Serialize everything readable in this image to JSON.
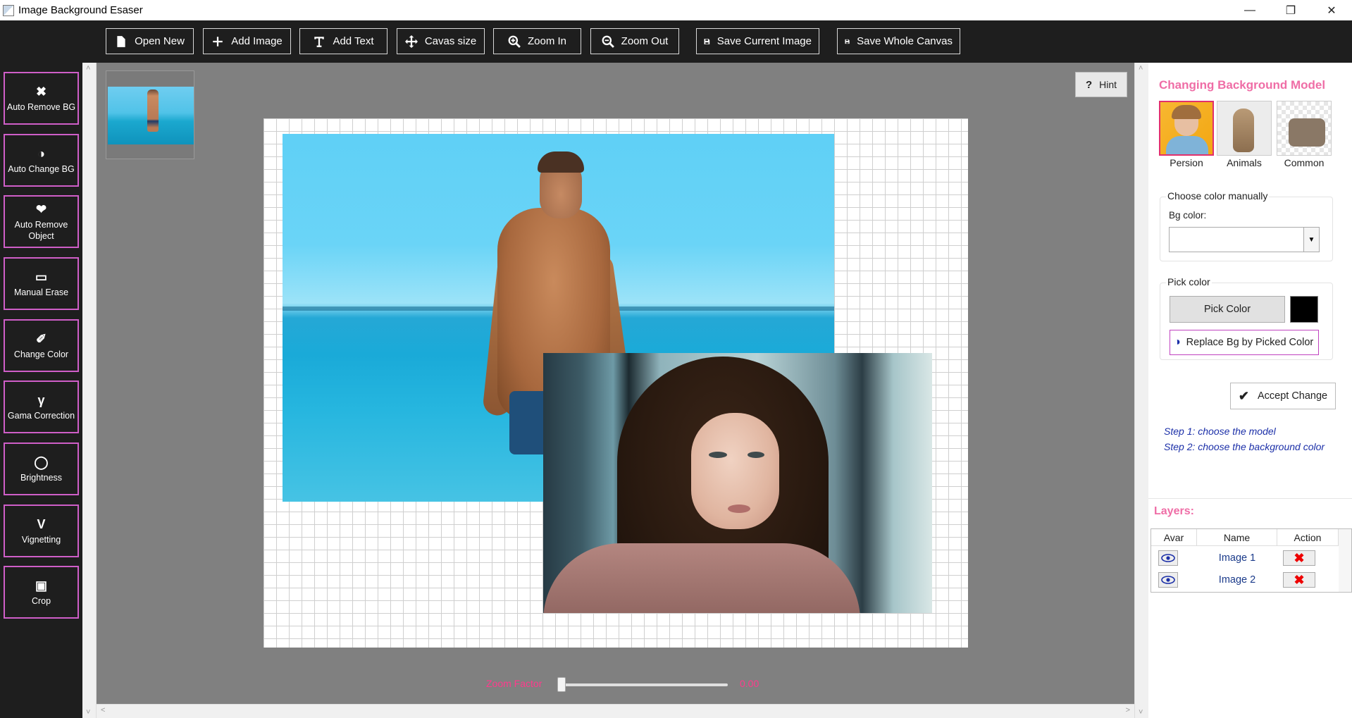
{
  "window": {
    "title": "Image Background Esaser",
    "minimize_icon": "minimize-icon",
    "maximize_icon": "restore-icon",
    "close_icon": "close-icon"
  },
  "toolbar": {
    "buttons": [
      {
        "label": "Open New",
        "icon": "file-icon"
      },
      {
        "label": "Add Image",
        "icon": "plus-icon"
      },
      {
        "label": "Add Text",
        "icon": "text-icon"
      },
      {
        "label": "Cavas size",
        "icon": "move-icon"
      },
      {
        "label": "Zoom In",
        "icon": "zoom-in-icon"
      },
      {
        "label": "Zoom Out",
        "icon": "zoom-out-icon"
      },
      {
        "label": "Save Current Image",
        "icon": "save-icon"
      },
      {
        "label": "Save Whole Canvas",
        "icon": "save-icon"
      }
    ]
  },
  "tools": [
    {
      "label": "Auto Remove BG",
      "icon": "x-icon"
    },
    {
      "label": "Auto Change BG",
      "icon": "contrast-icon"
    },
    {
      "label": "Auto Remove Object",
      "icon": "heart-icon"
    },
    {
      "label": "Manual Erase",
      "icon": "eraser-icon"
    },
    {
      "label": "Change Color",
      "icon": "brush-icon"
    },
    {
      "label": "Gama Correction",
      "icon": "gamma-icon"
    },
    {
      "label": "Brightness",
      "icon": "bulb-icon"
    },
    {
      "label": "Vignetting",
      "icon": "vimeo-icon"
    },
    {
      "label": "Crop",
      "icon": "crop-icon"
    }
  ],
  "canvas": {
    "hint_label": "Hint",
    "zoom_label": "Zoom Factor",
    "zoom_value": "0.00"
  },
  "panel": {
    "title": "Changing Background Model",
    "models": [
      {
        "label": "Persion",
        "selected": true
      },
      {
        "label": "Animals",
        "selected": false
      },
      {
        "label": "Common",
        "selected": false
      }
    ],
    "manual_group_title": "Choose color manually",
    "bg_color_label": "Bg color:",
    "bg_color_value": "",
    "pick_group_title": "Pick color",
    "pick_button": "Pick Color",
    "picked_color": "#000000",
    "replace_button": "Replace Bg by Picked Color",
    "accept_button": "Accept Change",
    "step1": "Step 1: choose the model",
    "step2": "Step 2: choose the background color",
    "layers_title": "Layers:",
    "layers_headers": [
      "Avar",
      "Name",
      "Action"
    ],
    "layers": [
      {
        "name": "Image 1"
      },
      {
        "name": "Image 2"
      }
    ]
  },
  "colors": {
    "accent_pink": "#ef6da6",
    "tool_border": "#cf5ec8",
    "dark_bg": "#1e1e1e",
    "step_text": "#1b2fa8"
  }
}
